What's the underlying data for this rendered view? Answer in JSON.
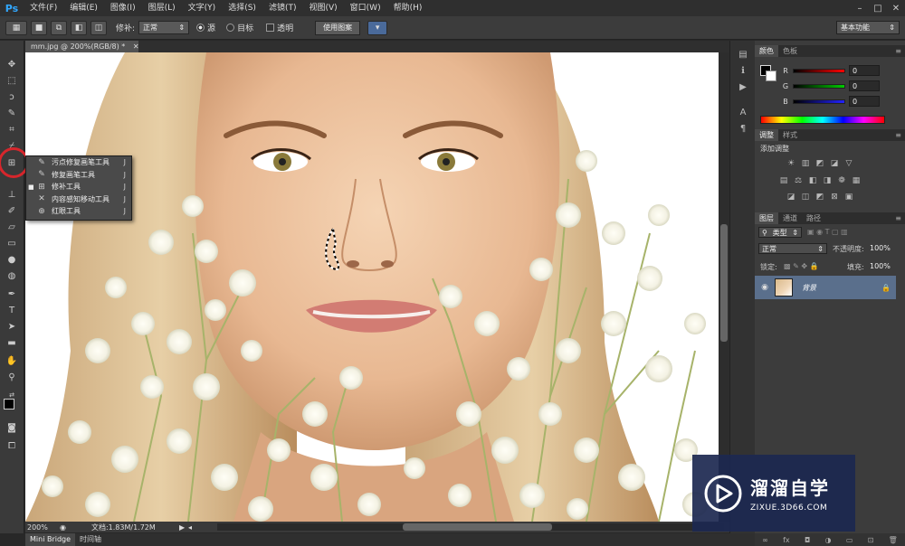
{
  "app": {
    "logo": "Ps"
  },
  "menu": [
    "文件(F)",
    "编辑(E)",
    "图像(I)",
    "图层(L)",
    "文字(Y)",
    "选择(S)",
    "滤镜(T)",
    "视图(V)",
    "窗口(W)",
    "帮助(H)"
  ],
  "window_controls": {
    "minimize": "–",
    "restore": "□",
    "close": "✕"
  },
  "options_bar": {
    "patch_label": "修补:",
    "patch_value": "正常",
    "source_label": "源",
    "destination_label": "目标",
    "transparent_label": "透明",
    "use_pattern_label": "使用图案",
    "workspace": "基本功能"
  },
  "document": {
    "tab_title": "mm.jpg @ 200%(RGB/8) *",
    "zoom": "200%",
    "doc_info": "文档:1.83M/1.72M"
  },
  "flyout": {
    "items": [
      {
        "label": "污点修复画笔工具",
        "key": "J",
        "icon": "spot-healing-brush-icon",
        "active": false
      },
      {
        "label": "修复画笔工具",
        "key": "J",
        "icon": "healing-brush-icon",
        "active": false
      },
      {
        "label": "修补工具",
        "key": "J",
        "icon": "patch-icon",
        "active": true
      },
      {
        "label": "内容感知移动工具",
        "key": "J",
        "icon": "content-aware-move-icon",
        "active": false
      },
      {
        "label": "红眼工具",
        "key": "J",
        "icon": "red-eye-icon",
        "active": false
      }
    ]
  },
  "bottom_tabs": [
    "Mini Bridge",
    "时间轴"
  ],
  "color_panel": {
    "tabs": [
      "颜色",
      "色板"
    ],
    "channels": [
      {
        "letter": "R",
        "value": "0",
        "color": "#e03030"
      },
      {
        "letter": "G",
        "value": "0",
        "color": "#30c030"
      },
      {
        "letter": "B",
        "value": "0",
        "color": "#3050e0"
      }
    ]
  },
  "adjustments_panel": {
    "tabs": [
      "调整",
      "样式"
    ],
    "heading": "添加调整"
  },
  "layers_panel": {
    "tabs": [
      "图层",
      "通道",
      "路径"
    ],
    "kind_label": "类型",
    "blend_mode": "正常",
    "opacity_label": "不透明度:",
    "opacity_value": "100%",
    "lock_label": "锁定:",
    "fill_label": "填充:",
    "fill_value": "100%",
    "layer_name": "背景"
  },
  "watermark": {
    "title": "溜溜自学",
    "url": "ZIXUE.3D66.COM"
  },
  "colors": {
    "highlight_ring": "#d7262c",
    "selected_layer": "#5a6f8c",
    "ps_blue": "#31a8ff"
  }
}
